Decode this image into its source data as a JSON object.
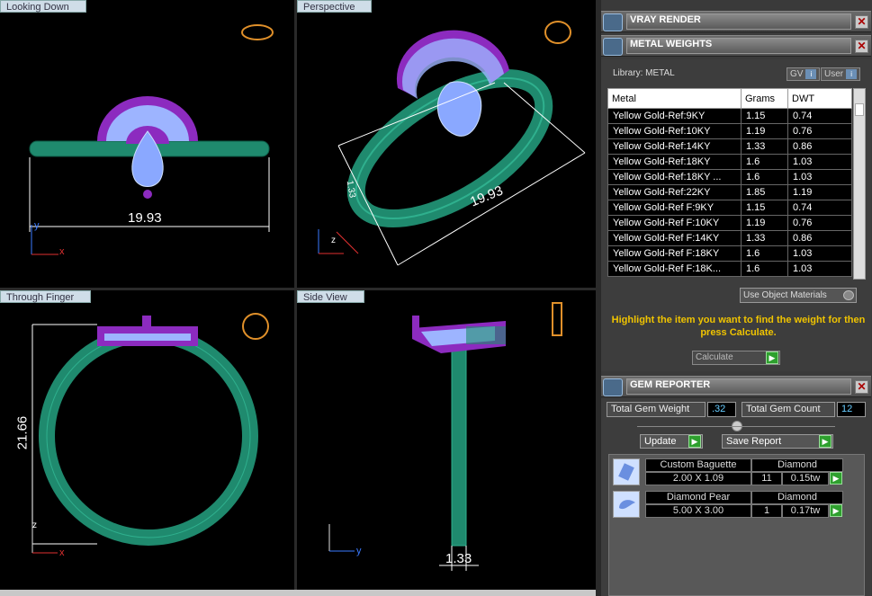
{
  "viewports": {
    "top_left": {
      "label": "Looking Down",
      "dimension": "19.93"
    },
    "top_right": {
      "label": "Perspective",
      "dimension": "19.93",
      "dimension2": "1.33"
    },
    "bottom_left": {
      "label": "Through Finger",
      "dimension": "21.66"
    },
    "bottom_right": {
      "label": "Side View",
      "dimension": "1.33"
    }
  },
  "axes": {
    "x": "x",
    "y": "y",
    "z": "z"
  },
  "vray": {
    "title": "VRAY RENDER"
  },
  "metal_weights": {
    "title": "METAL WEIGHTS",
    "library_label": "Library: METAL",
    "gv_label": "GV",
    "user_label": "User",
    "columns": [
      "Metal",
      "Grams",
      "DWT"
    ],
    "rows": [
      [
        "Yellow Gold-Ref:9KY",
        "1.15",
        "0.74"
      ],
      [
        "Yellow Gold-Ref:10KY",
        "1.19",
        "0.76"
      ],
      [
        "Yellow Gold-Ref:14KY",
        "1.33",
        "0.86"
      ],
      [
        "Yellow Gold-Ref:18KY",
        "1.6",
        "1.03"
      ],
      [
        "Yellow Gold-Ref:18KY ...",
        "1.6",
        "1.03"
      ],
      [
        "Yellow Gold-Ref:22KY",
        "1.85",
        "1.19"
      ],
      [
        "Yellow Gold-Ref F:9KY",
        "1.15",
        "0.74"
      ],
      [
        "Yellow Gold-Ref F:10KY",
        "1.19",
        "0.76"
      ],
      [
        "Yellow Gold-Ref F:14KY",
        "1.33",
        "0.86"
      ],
      [
        "Yellow Gold-Ref F:18KY",
        "1.6",
        "1.03"
      ],
      [
        "Yellow Gold-Ref F:18K...",
        "1.6",
        "1.03"
      ]
    ],
    "use_object_materials": "Use Object Materials",
    "hint": "Highlight the item you want to find the weight for then press Calculate.",
    "calculate_label": "Calculate"
  },
  "gem_reporter": {
    "title": "GEM REPORTER",
    "total_weight_label": "Total Gem Weight",
    "total_weight_value": ".32",
    "total_count_label": "Total Gem Count",
    "total_count_value": "12",
    "update_label": "Update",
    "save_report_label": "Save Report",
    "gems": [
      {
        "name": "Custom Baguette",
        "material": "Diamond",
        "size": "2.00 X 1.09",
        "count": "11",
        "weight": "0.15tw",
        "icon": "baguette-gem-icon"
      },
      {
        "name": "Diamond Pear",
        "material": "Diamond",
        "size": "5.00 X 3.00",
        "count": "1",
        "weight": "0.17tw",
        "icon": "pear-gem-icon"
      }
    ]
  },
  "colors": {
    "metal": "#1f8a6e",
    "setting": "#8c2bbf",
    "stone": "#8aa8ff",
    "accent": "#f0c400"
  }
}
